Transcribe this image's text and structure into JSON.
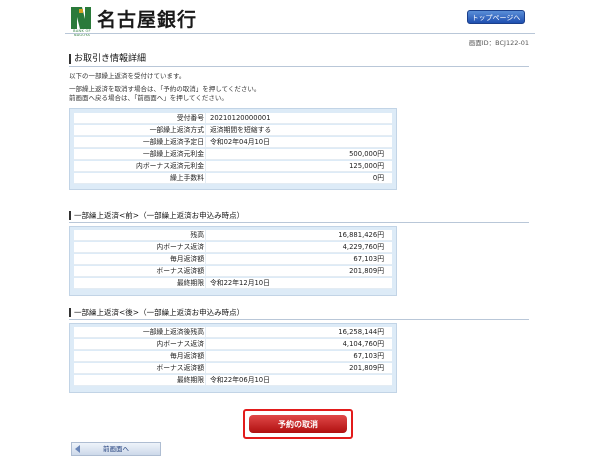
{
  "header": {
    "bank_name": "名古屋銀行",
    "logo_sub": "BANK OF NAGOYA",
    "top_button": "トップページへ",
    "screen_id": "画面ID：BCJ122-01"
  },
  "page_title": "お取引き情報詳細",
  "messages": [
    "以下の一部繰上返済を受付けています。",
    "一部繰上返済を取消す場合は、「予約の取消」を押してください。",
    "前画面へ戻る場合は、「前画面へ」を押してください。"
  ],
  "detail_rows": [
    {
      "label": "受付番号",
      "value": "20210120000001"
    },
    {
      "label": "一部繰上返済方式",
      "value": "返済期間を短縮する"
    },
    {
      "label": "一部繰上返済予定日",
      "value": "令和02年04月10日"
    },
    {
      "label": "一部繰上返済元利金",
      "value": "500,000円"
    },
    {
      "label": "内ボーナス返済元利金",
      "value": "125,000円"
    },
    {
      "label": "繰上手数料",
      "value": "0円"
    }
  ],
  "before": {
    "title": "一部繰上返済<前>（一部繰上返済お申込み時点）",
    "rows": [
      {
        "label": "残高",
        "value": "16,881,426円"
      },
      {
        "label": "内ボーナス返済",
        "value": "4,229,760円"
      },
      {
        "label": "毎月返済額",
        "value": "67,103円"
      },
      {
        "label": "ボーナス返済額",
        "value": "201,809円"
      },
      {
        "label": "最終期限",
        "value": "令和22年12月10日"
      }
    ]
  },
  "after": {
    "title": "一部繰上返済<後>（一部繰上返済お申込み時点）",
    "rows": [
      {
        "label": "一部繰上返済後残高",
        "value": "16,258,144円"
      },
      {
        "label": "内ボーナス返済",
        "value": "4,104,760円"
      },
      {
        "label": "毎月返済額",
        "value": "67,103円"
      },
      {
        "label": "ボーナス返済額",
        "value": "201,809円"
      },
      {
        "label": "最終期限",
        "value": "令和22年06月10日"
      }
    ]
  },
  "buttons": {
    "cancel": "予約の取消",
    "back": "前画面へ"
  },
  "colors": {
    "brand_green": "#2a7a3a",
    "panel_bg": "#ddebf7",
    "cancel_red": "#c41a1a",
    "highlight_border": "#e21b1b",
    "top_button_blue": "#2a5cc0"
  }
}
